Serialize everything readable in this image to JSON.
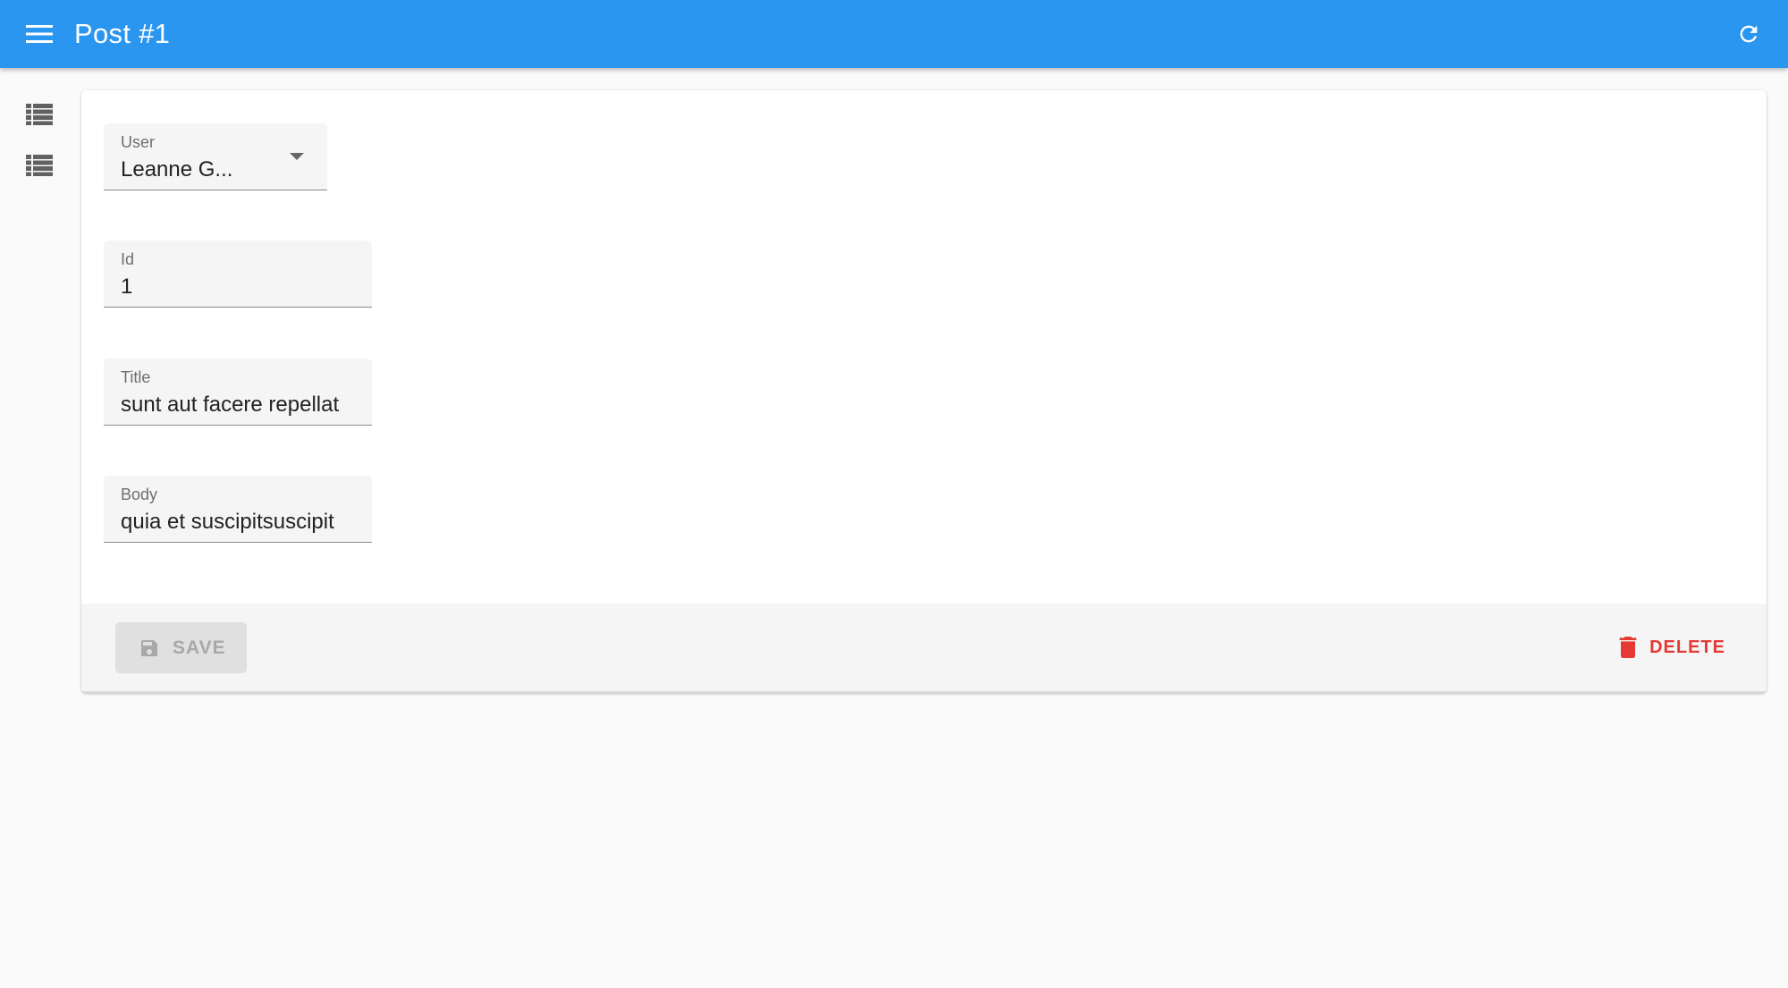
{
  "appbar": {
    "title": "Post #1",
    "menu_icon": "menu-icon",
    "refresh_icon": "refresh-icon",
    "color": "#2a96f0"
  },
  "sidebar": {
    "items": [
      {
        "icon": "list-icon"
      },
      {
        "icon": "list-icon"
      }
    ]
  },
  "form": {
    "user": {
      "label": "User",
      "value": "Leanne G..."
    },
    "id": {
      "label": "Id",
      "value": "1"
    },
    "title": {
      "label": "Title",
      "value": "sunt aut facere repellat"
    },
    "body": {
      "label": "Body",
      "value": "quia et suscipitsuscipit"
    }
  },
  "toolbar": {
    "save_label": "SAVE",
    "save_icon": "save-icon",
    "delete_label": "DELETE",
    "delete_icon": "trash-icon",
    "delete_color": "#e53935"
  }
}
